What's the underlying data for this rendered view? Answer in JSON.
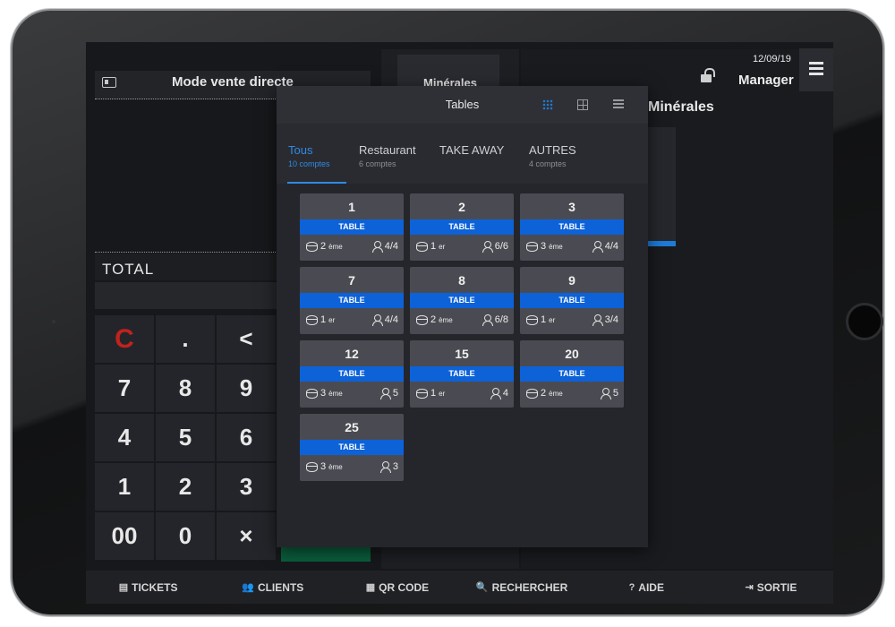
{
  "left": {
    "mode_title": "Mode vente directe",
    "total_label": "TOTAL"
  },
  "keypad": [
    "C",
    ".",
    "<",
    "7",
    "8",
    "9",
    "4",
    "5",
    "6",
    "1",
    "2",
    "3",
    "00",
    "0",
    "×"
  ],
  "middle": {
    "category_label": "Minérales"
  },
  "right": {
    "date": "12/09/19",
    "user": "Manager",
    "category_title": "Minérales"
  },
  "modal": {
    "title": "Tables",
    "tabs": [
      {
        "label": "Tous",
        "count": "10 comptes",
        "active": true
      },
      {
        "label": "Restaurant",
        "count": "6 comptes",
        "active": false
      },
      {
        "label": "TAKE AWAY",
        "count": "",
        "active": false
      },
      {
        "label": "AUTRES",
        "count": "4 comptes",
        "active": false
      }
    ],
    "tables": [
      {
        "number": "1",
        "type": "TABLE",
        "service": "2",
        "service_sup": "ème",
        "guests": "4/4"
      },
      {
        "number": "2",
        "type": "TABLE",
        "service": "1",
        "service_sup": "er",
        "guests": "6/6"
      },
      {
        "number": "3",
        "type": "TABLE",
        "service": "3",
        "service_sup": "ème",
        "guests": "4/4"
      },
      {
        "number": "7",
        "type": "TABLE",
        "service": "1",
        "service_sup": "er",
        "guests": "4/4"
      },
      {
        "number": "8",
        "type": "TABLE",
        "service": "2",
        "service_sup": "ème",
        "guests": "6/8"
      },
      {
        "number": "9",
        "type": "TABLE",
        "service": "1",
        "service_sup": "er",
        "guests": "3/4"
      },
      {
        "number": "12",
        "type": "TABLE",
        "service": "3",
        "service_sup": "ème",
        "guests": "5"
      },
      {
        "number": "15",
        "type": "TABLE",
        "service": "1",
        "service_sup": "er",
        "guests": "4"
      },
      {
        "number": "20",
        "type": "TABLE",
        "service": "2",
        "service_sup": "ème",
        "guests": "5"
      },
      {
        "number": "25",
        "type": "TABLE",
        "service": "3",
        "service_sup": "ème",
        "guests": "3"
      }
    ]
  },
  "bottom_nav": [
    {
      "label": "TICKETS",
      "icon": "ticket-icon",
      "glyph": "▤"
    },
    {
      "label": "CLIENTS",
      "icon": "users-icon",
      "glyph": "👥"
    },
    {
      "label": "QR CODE",
      "icon": "qr-icon",
      "glyph": "▦"
    },
    {
      "label": "RECHERCHER",
      "icon": "search-icon",
      "glyph": "🔍"
    },
    {
      "label": "AIDE",
      "icon": "help-icon",
      "glyph": "?"
    },
    {
      "label": "SORTIE",
      "icon": "exit-icon",
      "glyph": "⇥"
    }
  ],
  "colors": {
    "accent": "#2f8ae6",
    "table_badge": "#0d62d8",
    "clear_key": "#c0221d",
    "validate": "#0a5e3c"
  }
}
